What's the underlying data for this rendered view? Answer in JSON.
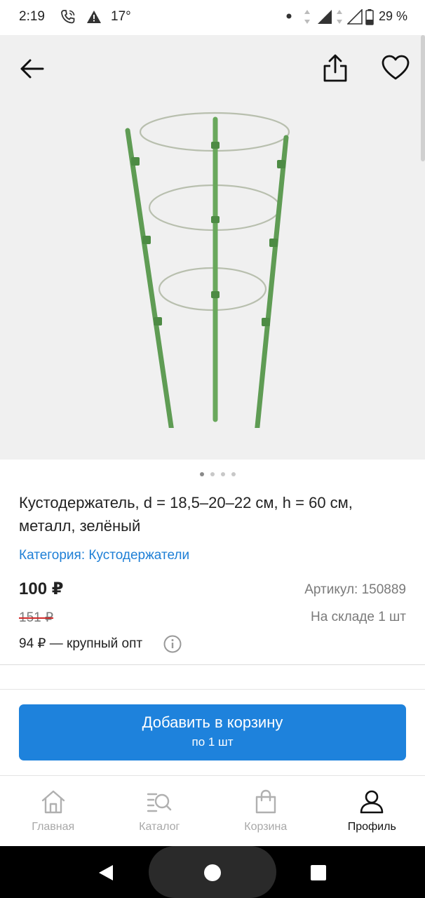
{
  "status_bar": {
    "time": "2:19",
    "temperature": "17°",
    "battery": "29 %",
    "icons": [
      "phone-wifi-call-icon",
      "warning-icon",
      "dot-icon",
      "data-arrows-icon",
      "signal-icon",
      "signal-empty-icon",
      "battery-icon"
    ]
  },
  "image_toolbar": {
    "back_icon": "arrow-left-icon",
    "share_icon": "share-icon",
    "favorite_icon": "heart-icon"
  },
  "carousel": {
    "count": 4,
    "active_index": 0
  },
  "product": {
    "title": "Кустодержатель, d = 18,5–20–22 см, h = 60 см, металл, зелёный",
    "category": "Категория: Кустодержатели",
    "price": "100 ₽",
    "old_price": "151 ₽",
    "article": "Артикул: 150889",
    "stock": "На складе 1 шт",
    "wholesale": "94 ₽ — крупный опт"
  },
  "cart_button": {
    "label": "Добавить в корзину",
    "sub_label": "по 1 шт"
  },
  "bottom_nav": {
    "items": [
      {
        "label": "Главная",
        "icon": "home-icon",
        "active": false
      },
      {
        "label": "Каталог",
        "icon": "catalog-search-icon",
        "active": false
      },
      {
        "label": "Корзина",
        "icon": "cart-bag-icon",
        "active": false
      },
      {
        "label": "Профиль",
        "icon": "profile-icon",
        "active": true
      }
    ]
  },
  "colors": {
    "accent": "#1e82dc",
    "link": "#1e7fd6",
    "old_price_strike": "#d12b2b",
    "image_bg": "#f0f0f0",
    "product_green": "#6aa85a"
  }
}
